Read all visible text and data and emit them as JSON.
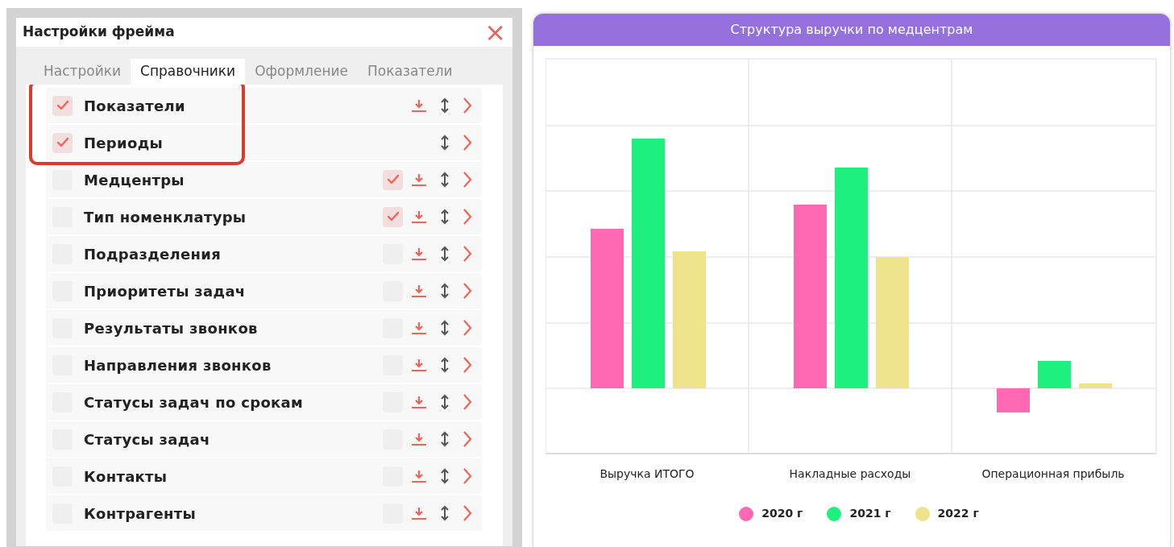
{
  "dialog": {
    "title": "Настройки фрейма",
    "close": "×"
  },
  "tabs": [
    {
      "label": "Настройки",
      "selected": false
    },
    {
      "label": "Справочники",
      "selected": true
    },
    {
      "label": "Оформление",
      "selected": false
    },
    {
      "label": "Показатели",
      "selected": false
    }
  ],
  "rows": [
    {
      "label": "Показатели",
      "checked": true,
      "highlighted": true,
      "export": true
    },
    {
      "label": "Периоды",
      "checked": true,
      "highlighted": true,
      "export": false
    },
    {
      "label": "Медцентры",
      "checked": false,
      "highlighted": false,
      "export": true,
      "option_checked": true
    },
    {
      "label": "Тип номенклатуры",
      "checked": false,
      "highlighted": false,
      "export": true,
      "option_checked": true
    },
    {
      "label": "Подразделения",
      "checked": false,
      "highlighted": false,
      "export": true,
      "option_checked": false
    },
    {
      "label": "Приоритеты задач",
      "checked": false,
      "highlighted": false,
      "export": true,
      "option_checked": false
    },
    {
      "label": "Результаты звонков",
      "checked": false,
      "highlighted": false,
      "export": true,
      "option_checked": false
    },
    {
      "label": "Направления звонков",
      "checked": false,
      "highlighted": false,
      "export": true,
      "option_checked": false
    },
    {
      "label": "Статусы задач по срокам",
      "checked": false,
      "highlighted": false,
      "export": true,
      "option_checked": false
    },
    {
      "label": "Статусы задач",
      "checked": false,
      "highlighted": false,
      "export": true,
      "option_checked": false
    },
    {
      "label": "Контакты",
      "checked": false,
      "highlighted": false,
      "export": true,
      "option_checked": false
    },
    {
      "label": "Контрагенты",
      "checked": false,
      "highlighted": false,
      "export": true,
      "option_checked": false
    }
  ],
  "chart": {
    "title": "Структура выручки по медцентрам",
    "categories": [
      "Выручка ИТОГО",
      "Накладные расходы",
      "Операционная прибыль"
    ],
    "legend": [
      {
        "label": "2020 г",
        "color": "#ff69b4"
      },
      {
        "label": "2021 г",
        "color": "#1ef07f"
      },
      {
        "label": "2022 г",
        "color": "#eee28a"
      }
    ]
  }
}
